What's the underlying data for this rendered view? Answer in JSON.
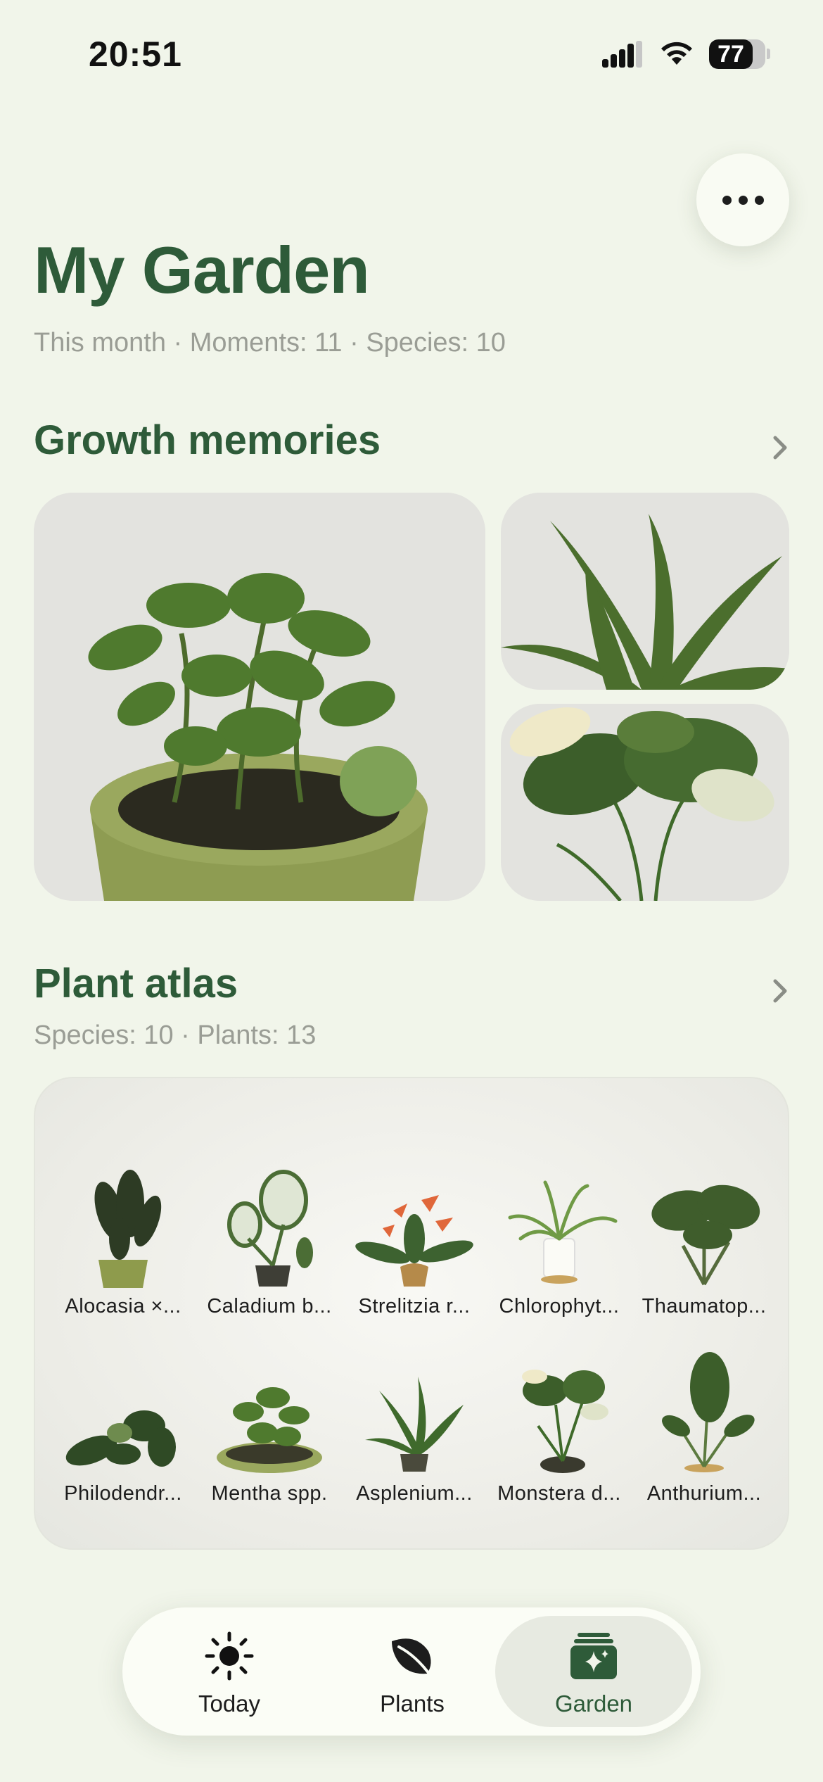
{
  "status_bar": {
    "time": "20:51",
    "battery": "77",
    "battery_level": 0.77
  },
  "header": {
    "title": "My Garden",
    "subtitle": "This month · Moments: 11 · Species: 10",
    "more_icon": "ellipsis-icon"
  },
  "growth_memories": {
    "title": "Growth memories",
    "photos": [
      "mint-pot-photo",
      "asplenium-photo",
      "monstera-photo"
    ]
  },
  "plant_atlas": {
    "title": "Plant atlas",
    "subtitle": "Species: 10 · Plants: 13",
    "items": [
      {
        "name": "Alocasia ×..."
      },
      {
        "name": "Caladium b..."
      },
      {
        "name": "Strelitzia r..."
      },
      {
        "name": "Chlorophyt..."
      },
      {
        "name": "Thaumatop..."
      },
      {
        "name": "Philodendr..."
      },
      {
        "name": "Mentha spp."
      },
      {
        "name": "Asplenium..."
      },
      {
        "name": "Monstera d..."
      },
      {
        "name": "Anthurium..."
      }
    ]
  },
  "tabbar": {
    "tabs": [
      {
        "label": "Today",
        "icon": "sun-icon"
      },
      {
        "label": "Plants",
        "icon": "leaf-icon"
      },
      {
        "label": "Garden",
        "icon": "sparkle-stack-icon"
      }
    ],
    "active": "Garden"
  },
  "colors": {
    "accent": "#2e5b39",
    "background": "#f1f5ea",
    "muted": "#9a9d95"
  }
}
